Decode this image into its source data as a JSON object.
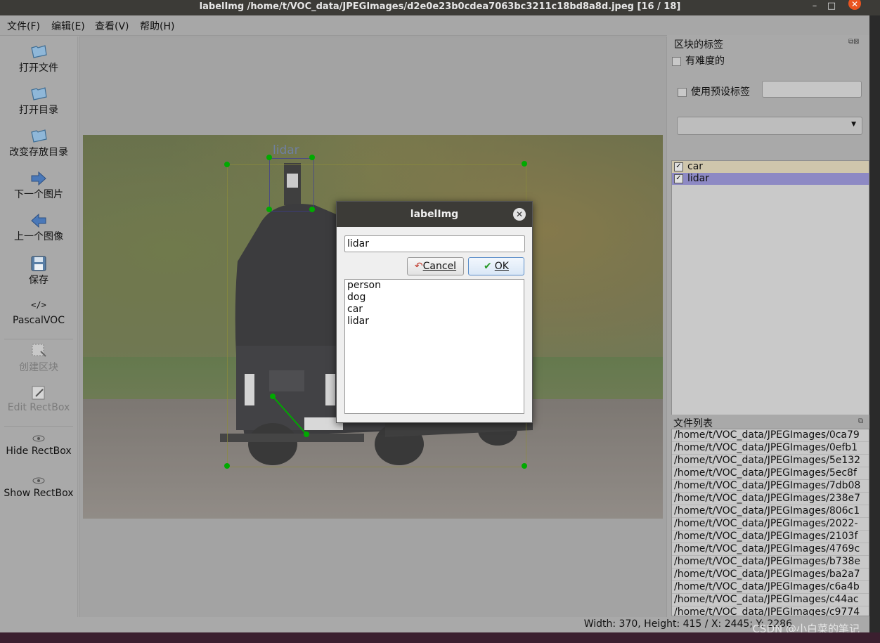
{
  "window": {
    "title": "labelImg /home/t/VOC_data/JPEGImages/d2e0e23b0cdea7063bc3211c18bd8a8d.jpeg [16 / 18]",
    "minimize": "–",
    "maximize": "□",
    "close": "✕"
  },
  "menu": {
    "file": "文件(F)",
    "edit": "编辑(E)",
    "view": "查看(V)",
    "help": "帮助(H)"
  },
  "toolbar": {
    "open_file": "打开文件",
    "open_dir": "打开目录",
    "change_save_dir": "改变存放目录",
    "next_image": "下一个图片",
    "prev_image": "上一个图像",
    "save": "保存",
    "format_icon_text": "</>",
    "format": "PascalVOC",
    "create_rectbox": "创建区块",
    "edit_rectbox": "Edit RectBox",
    "hide_rectbox": "Hide RectBox",
    "show_rectbox": "Show RectBox"
  },
  "canvas": {
    "box_label": "lidar"
  },
  "labels_dock": {
    "title": "区块的标签",
    "difficult": "有难度的",
    "use_default_label": "使用预设标签",
    "default_label_value": "",
    "combo_value": "",
    "items": [
      {
        "label": "car",
        "checked": "✓"
      },
      {
        "label": "lidar",
        "checked": "✓"
      }
    ]
  },
  "file_dock": {
    "title": "文件列表",
    "files": [
      "/home/t/VOC_data/JPEGImages/0ca79",
      "/home/t/VOC_data/JPEGImages/0efb1",
      "/home/t/VOC_data/JPEGImages/5e132",
      "/home/t/VOC_data/JPEGImages/5ec8f",
      "/home/t/VOC_data/JPEGImages/7db08",
      "/home/t/VOC_data/JPEGImages/238e7",
      "/home/t/VOC_data/JPEGImages/806c1",
      "/home/t/VOC_data/JPEGImages/2022-",
      "/home/t/VOC_data/JPEGImages/2103f",
      "/home/t/VOC_data/JPEGImages/4769c",
      "/home/t/VOC_data/JPEGImages/b738e",
      "/home/t/VOC_data/JPEGImages/ba2a7",
      "/home/t/VOC_data/JPEGImages/c6a4b",
      "/home/t/VOC_data/JPEGImages/c44ac",
      "/home/t/VOC_data/JPEGImages/c9774"
    ]
  },
  "status": {
    "text": "Width: 370, Height: 415 / X: 2445; Y: 2286"
  },
  "watermark": "CSDN @小白菜的笔记",
  "dialog": {
    "title": "labelImg",
    "close": "✕",
    "input_value": "lidar",
    "cancel": "Cancel",
    "ok": "OK",
    "options": [
      "person",
      "dog",
      "car",
      "lidar"
    ]
  },
  "colors": {
    "selected_row": "#8d89c4",
    "first_row": "#cfc6ac",
    "point": "#00aa00"
  }
}
